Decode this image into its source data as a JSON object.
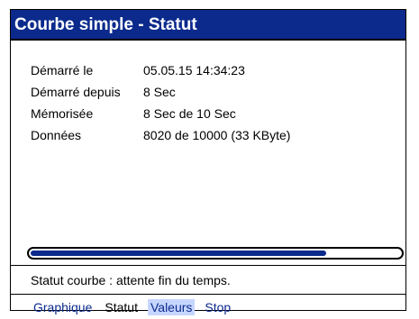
{
  "window": {
    "title": "Courbe simple - Statut"
  },
  "info": [
    {
      "label": "Démarré le",
      "value": "05.05.15  14:34:23"
    },
    {
      "label": "Démarré depuis",
      "value": "8 Sec"
    },
    {
      "label": "Mémorisée",
      "value": "8 Sec de 10 Sec"
    },
    {
      "label": "Données",
      "value": "8020 de 10000  (33 KByte)"
    }
  ],
  "progress": {
    "fraction": 0.8
  },
  "status": {
    "text": "Statut courbe : attente fin du temps."
  },
  "menu": [
    {
      "label": "Graphique"
    },
    {
      "label": "Statut"
    },
    {
      "label": "Valeurs"
    },
    {
      "label": "Stop"
    }
  ],
  "colors": {
    "title_bg": "#0b2a8c",
    "accent": "#0b2a8c",
    "highlight": "#c6d6ff"
  }
}
